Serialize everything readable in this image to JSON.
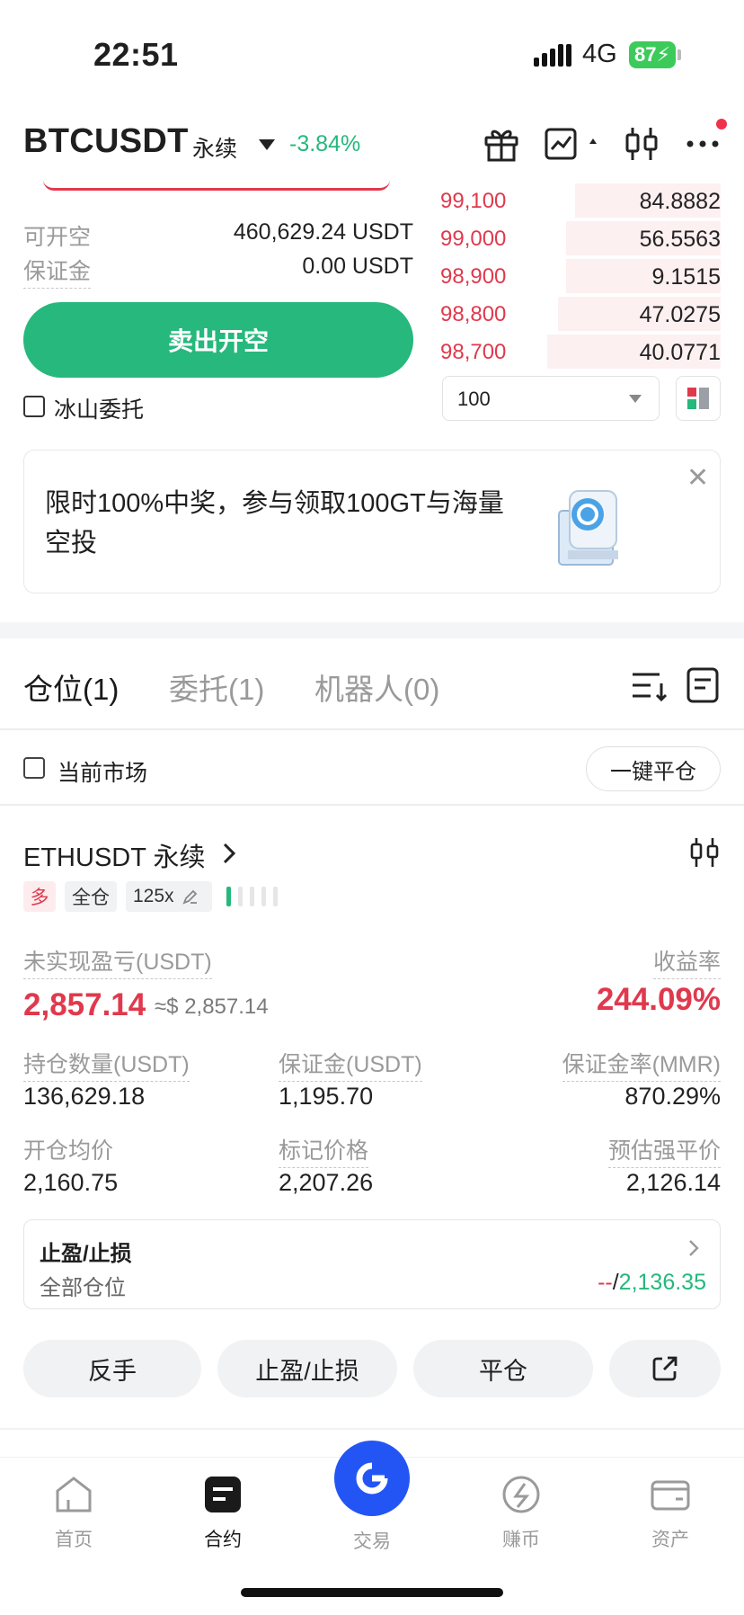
{
  "status_bar": {
    "time": "22:51",
    "network": "4G",
    "battery": "87"
  },
  "header": {
    "symbol": "BTCUSDT",
    "contract_type": "永续",
    "change": "-3.84%",
    "icons": [
      "gift-icon",
      "chart-icon",
      "candlestick-icon",
      "more-icon"
    ]
  },
  "order_form": {
    "available_label": "可开空",
    "available_value": "460,629.24 USDT",
    "margin_label": "保证金",
    "margin_value": "0.00 USDT",
    "sell_button": "卖出开空",
    "iceberg_label": "冰山委托"
  },
  "order_book": {
    "asks": [
      {
        "price": "99,100",
        "qty": "84.8882",
        "depth": 0.52
      },
      {
        "price": "99,000",
        "qty": "56.5563",
        "depth": 0.55
      },
      {
        "price": "98,900",
        "qty": "9.1515",
        "depth": 0.55
      },
      {
        "price": "98,800",
        "qty": "47.0275",
        "depth": 0.58
      },
      {
        "price": "98,700",
        "qty": "40.0771",
        "depth": 0.62
      }
    ],
    "depth_value": "100"
  },
  "banner": {
    "text": "限时100%中奖，参与领取100GT与海量空投"
  },
  "tabs": [
    {
      "label": "仓位(1)",
      "active": true
    },
    {
      "label": "委托(1)",
      "active": false
    },
    {
      "label": "机器人(0)",
      "active": false
    }
  ],
  "filters": {
    "current_market": "当前市场",
    "close_all": "一键平仓"
  },
  "position": {
    "symbol": "ETHUSDT 永续",
    "side": "多",
    "margin_mode": "全仓",
    "leverage": "125x",
    "unrealized_label": "未实现盈亏(USDT)",
    "unrealized_value": "2,857.14",
    "unrealized_approx": "≈$ 2,857.14",
    "roe_label": "收益率",
    "roe_value": "244.09%",
    "size_label": "持仓数量(USDT)",
    "size_value": "136,629.18",
    "margin_label": "保证金(USDT)",
    "margin_value": "1,195.70",
    "mmr_label": "保证金率(MMR)",
    "mmr_value": "870.29%",
    "entry_label": "开仓均价",
    "entry_value": "2,160.75",
    "mark_label": "标记价格",
    "mark_value": "2,207.26",
    "liq_label": "预估强平价",
    "liq_value": "2,126.14",
    "tpsl_title": "止盈/止损",
    "tpsl_scope": "全部仓位",
    "tpsl_tp": "--",
    "tpsl_sep": "/",
    "tpsl_sl": "2,136.35"
  },
  "actions": {
    "reverse": "反手",
    "tpsl": "止盈/止损",
    "close": "平仓"
  },
  "nav": {
    "home": "首页",
    "futures": "合约",
    "trade": "交易",
    "earn": "赚币",
    "assets": "资产"
  },
  "colors": {
    "red": "#e0394d",
    "green": "#25b87c",
    "accent": "#2355f5"
  }
}
